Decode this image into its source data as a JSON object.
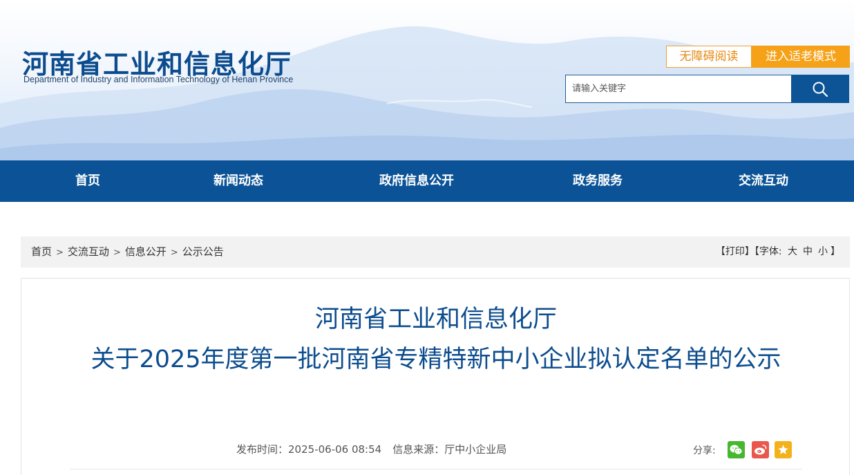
{
  "header": {
    "site_title": "河南省工业和信息化厅",
    "site_subtitle": "Department of Industry and Information Technology of Henan Province",
    "accessible_label": "无障碍阅读",
    "elder_mode_label": "进入适老模式",
    "search": {
      "placeholder": "请输入关键字",
      "icon": "search-icon"
    }
  },
  "nav": {
    "items": [
      {
        "label": "首页"
      },
      {
        "label": "新闻动态"
      },
      {
        "label": "政府信息公开"
      },
      {
        "label": "政务服务"
      },
      {
        "label": "交流互动"
      }
    ]
  },
  "breadcrumb": {
    "items": [
      "首页",
      "交流互动",
      "信息公开",
      "公示公告"
    ],
    "separator": ">"
  },
  "tools": {
    "print": "【打印】",
    "font_prefix": "【字体:",
    "font_large": "大",
    "font_medium": "中",
    "font_small": "小",
    "font_suffix": "】"
  },
  "article": {
    "title_line1": "河南省工业和信息化厅",
    "title_line2": "关于2025年度第一批河南省专精特新中小企业拟认定名单的公示",
    "publish_label": "发布时间：",
    "publish_time": "2025-06-06 08:54",
    "source_label": "信息来源：",
    "source": "厅中小企业局",
    "share_label": "分享:",
    "share_icons": [
      "wechat-icon",
      "weibo-icon",
      "favorite-star-icon"
    ]
  },
  "colors": {
    "primary": "#0b5396",
    "title_blue": "#0c4c8e",
    "orange": "#f6a219",
    "wechat": "#46b72e",
    "weibo": "#e8584c",
    "star": "#f3b21b"
  }
}
